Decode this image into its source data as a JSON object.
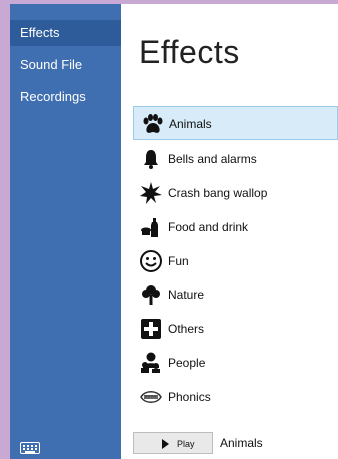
{
  "sidebar": {
    "items": [
      {
        "label": "Effects"
      },
      {
        "label": "Sound File"
      },
      {
        "label": "Recordings"
      }
    ]
  },
  "main": {
    "title": "Effects",
    "categories": [
      {
        "label": "Animals",
        "icon": "paw-icon"
      },
      {
        "label": "Bells and alarms",
        "icon": "bell-icon"
      },
      {
        "label": "Crash bang wallop",
        "icon": "explosion-icon"
      },
      {
        "label": "Food and drink",
        "icon": "food-drink-icon"
      },
      {
        "label": "Fun",
        "icon": "smiley-icon"
      },
      {
        "label": "Nature",
        "icon": "tree-icon"
      },
      {
        "label": "Others",
        "icon": "plus-icon"
      },
      {
        "label": "People",
        "icon": "people-icon"
      },
      {
        "label": "Phonics",
        "icon": "mouth-icon"
      }
    ],
    "selected": "Animals"
  },
  "footer": {
    "play_label": "Play",
    "current_sound": "Animals"
  },
  "colors": {
    "sidebar_bg": "#3f6fb0",
    "selected_row_bg": "#d7ebf8",
    "selected_row_border": "#9ccbe9",
    "frame_bg": "#c8a9d3"
  }
}
